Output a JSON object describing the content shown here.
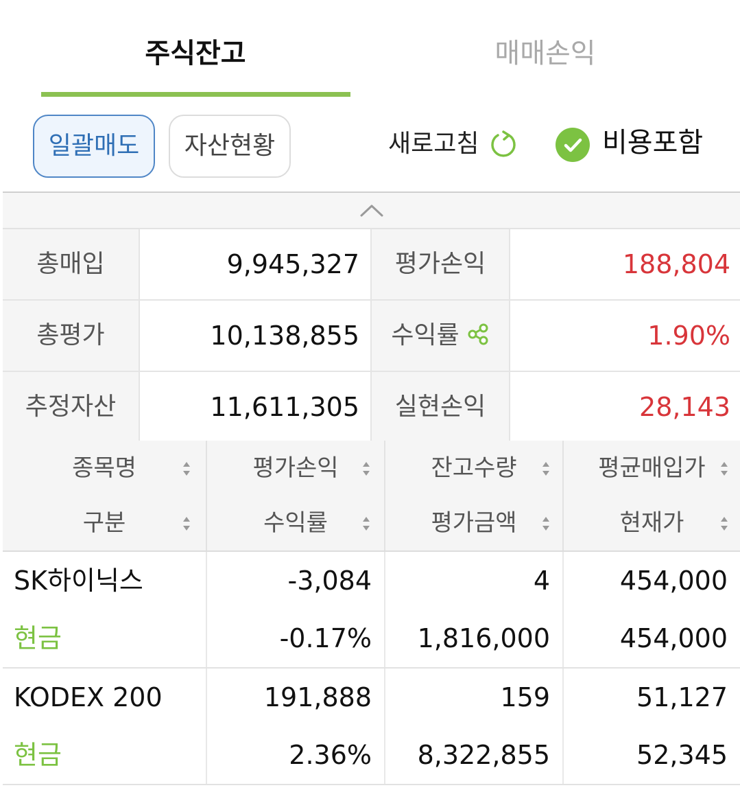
{
  "tabs": {
    "active": "주식잔고",
    "inactive": "매매손익"
  },
  "toolbar": {
    "sell_all": "일괄매도",
    "asset_status": "자산현황",
    "refresh": "새로고침",
    "include_fees": "비용포함"
  },
  "summary": {
    "total_purchase_label": "총매입",
    "total_purchase": "9,945,327",
    "eval_pl_label": "평가손익",
    "eval_pl": "188,804",
    "total_eval_label": "총평가",
    "total_eval": "10,138,855",
    "return_label": "수익률",
    "return": "1.90%",
    "est_assets_label": "추정자산",
    "est_assets": "11,611,305",
    "realized_pl_label": "실현손익",
    "realized_pl": "28,143"
  },
  "holdings": {
    "headers": {
      "name": "종목명",
      "type": "구분",
      "eval_pl": "평가손익",
      "return": "수익률",
      "qty": "잔고수량",
      "eval_amount": "평가금액",
      "avg_price": "평균매입가",
      "current_price": "현재가"
    },
    "rows": [
      {
        "name": "SK하이닉스",
        "type": "현금",
        "eval_pl": "-3,084",
        "return": "-0.17%",
        "qty": "4",
        "eval_amount": "1,816,000",
        "avg_price": "454,000",
        "current_price": "454,000"
      },
      {
        "name": "KODEX 200",
        "type": "현금",
        "eval_pl": "191,888",
        "return": "2.36%",
        "qty": "159",
        "eval_amount": "8,322,855",
        "avg_price": "51,127",
        "current_price": "52,345"
      }
    ]
  },
  "colors": {
    "accent_green": "#8cc152",
    "positive": "#d8353a",
    "negative": "#3e86cf",
    "button_blue": "#4f86c6"
  },
  "icons": [
    "refresh-icon",
    "check-icon",
    "chevron-up-icon",
    "share-icon",
    "sort-icon"
  ]
}
